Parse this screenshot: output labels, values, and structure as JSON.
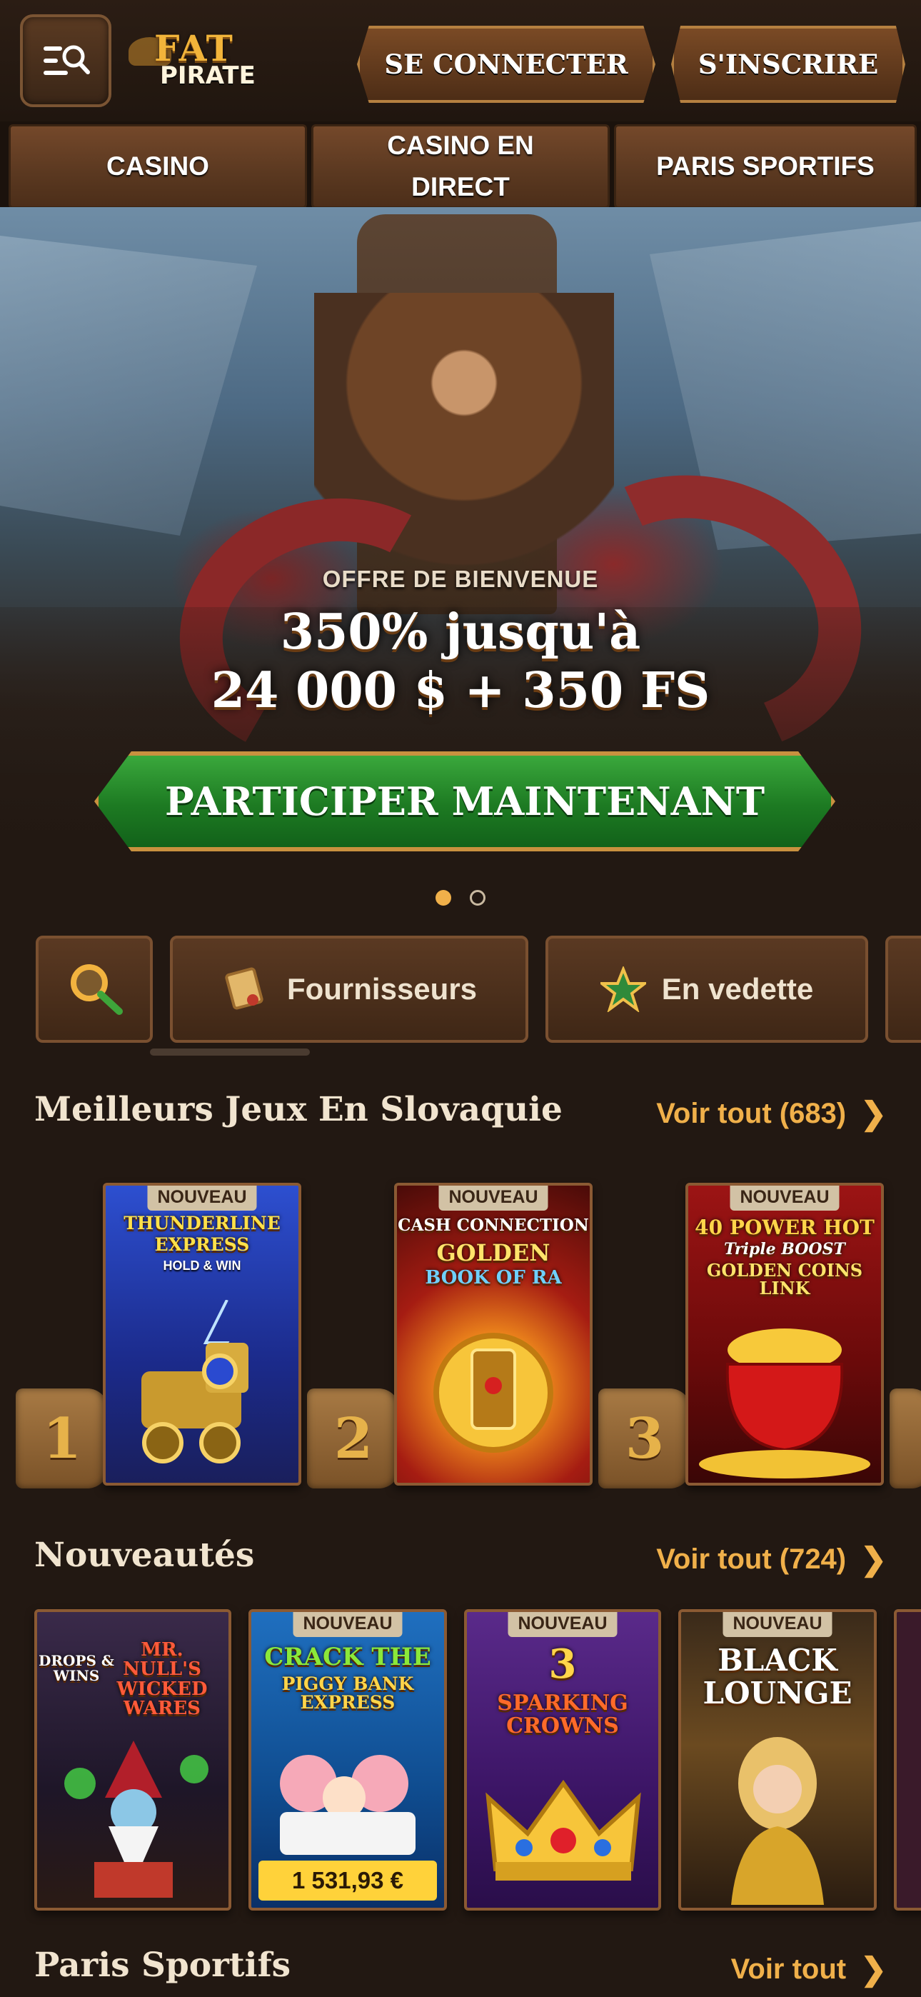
{
  "header": {
    "logo_top": "FAT",
    "logo_bottom": "PIRATE",
    "login_label": "SE CONNECTER",
    "register_label": "S'INSCRIRE"
  },
  "nav": {
    "tabs": [
      {
        "label": "CASINO"
      },
      {
        "label": "CASINO EN DIRECT"
      },
      {
        "label": "PARIS SPORTIFS"
      }
    ]
  },
  "hero": {
    "kicker": "OFFRE DE BIENVENUE",
    "line1": "350% jusqu'à",
    "line2": "24 000 $ + 350 FS",
    "cta_label": "PARTICIPER MAINTENANT",
    "slides_total": 2,
    "active_slide": 1
  },
  "filters": {
    "providers_label": "Fournisseurs",
    "featured_label": "En vedette"
  },
  "top_games": {
    "title": "Meilleurs Jeux En Slovaquie",
    "see_all": "Voir tout (683)",
    "items": [
      {
        "rank": "1",
        "badge": "NOUVEAU",
        "name_line1": "THUNDERLINE",
        "name_line2": "EXPRESS",
        "sub": "HOLD & WIN"
      },
      {
        "rank": "2",
        "badge": "NOUVEAU",
        "name_line1": "CASH CONNECTION",
        "name_line2": "GOLDEN",
        "sub": "BOOK OF RA"
      },
      {
        "rank": "3",
        "badge": "NOUVEAU",
        "name_line1": "40 POWER HOT",
        "name_line2": "Triple BOOST",
        "sub": "GOLDEN COINS LINK"
      }
    ]
  },
  "new_games": {
    "title": "Nouveautés",
    "see_all": "Voir tout (724)",
    "items": [
      {
        "badge": "",
        "name_line1": "DROPS & WINS",
        "name_line2": "MR. NULL'S WICKED WARES",
        "jackpot": ""
      },
      {
        "badge": "NOUVEAU",
        "name_line1": "CRACK THE",
        "name_line2": "PIGGY BANK EXPRESS",
        "jackpot": "1 531,93 €"
      },
      {
        "badge": "NOUVEAU",
        "name_line1": "3",
        "name_line2": "SPARKING CROWNS",
        "jackpot": ""
      },
      {
        "badge": "NOUVEAU",
        "name_line1": "BLACK",
        "name_line2": "LOUNGE",
        "jackpot": ""
      }
    ]
  },
  "sports": {
    "title": "Paris Sportifs",
    "see_all": "Voir tout"
  },
  "colors": {
    "background": "#221812",
    "accent_gold": "#f0b04a",
    "cta_green": "#1d7a22",
    "wood": "#5a3820"
  }
}
